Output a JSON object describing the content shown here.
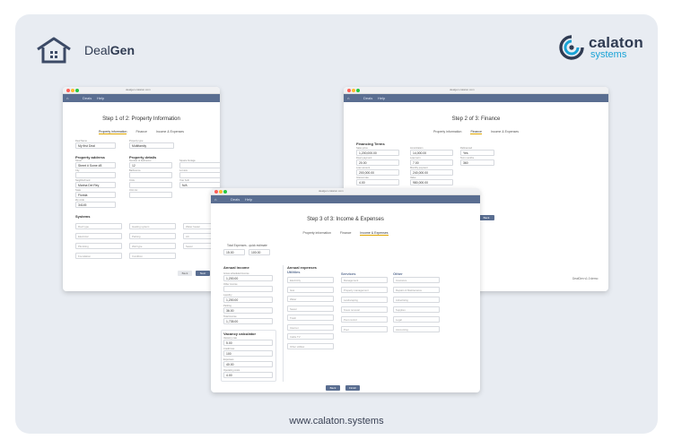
{
  "brand": {
    "left": {
      "regular": "Deal",
      "bold": "Gen"
    },
    "right": {
      "name": "calaton",
      "sub": "systems"
    }
  },
  "footer": {
    "url": "www.calaton.systems"
  },
  "window_common": {
    "url": "dealgen.calaton.com",
    "menu_deals": "Deals",
    "menu_help": "Help"
  },
  "win1": {
    "title": "Step 1 of 2: Property Information",
    "tabs": [
      "Property information",
      "Finance",
      "Income & Expenses"
    ],
    "top": {
      "lbl1": "Deal Name",
      "val1": "My first Deal",
      "lbl2": "Property type",
      "val2": "Multifamily"
    },
    "sections": {
      "address": "Property address",
      "details": "Property details",
      "systems": "Systems"
    },
    "address": [
      {
        "label": "Street",
        "value": "Street # Some #8"
      },
      {
        "label": "City",
        "value": ""
      },
      {
        "label": "Neighborhood",
        "value": "Marina Del Rey"
      },
      {
        "label": "State",
        "value": "Florida"
      },
      {
        "label": "Zip code",
        "value": "34145"
      }
    ],
    "details": [
      {
        "label": "Number of bedrooms",
        "value": "12"
      },
      {
        "label": "Bathrooms",
        "value": ""
      },
      {
        "label": "Units",
        "value": ""
      },
      {
        "label": "Unit mix",
        "value": ""
      },
      {
        "label": "Square footage",
        "value": ""
      },
      {
        "label": "Lot size",
        "value": ""
      },
      {
        "label": "Year built",
        "value": "N/A"
      }
    ],
    "systems": [
      "Roof type",
      "Heating system",
      "Water heater",
      "Electrical",
      "Parking",
      "AC",
      "Plumbing",
      "Well type",
      "Sewer",
      "Foundation",
      "Condition"
    ],
    "buttons": {
      "back": "Back",
      "next": "Next"
    }
  },
  "win2": {
    "title": "Step 2 of 3: Finance",
    "tabs": [
      "Property information",
      "Finance",
      "Income & Expenses"
    ],
    "section": "Financing Terms",
    "fields": [
      {
        "label": "Sales price",
        "value": "1,200,000.00"
      },
      {
        "label": "Down payment",
        "value": "20.00"
      },
      {
        "label": "Loan amount",
        "value": "200,000.00"
      },
      {
        "label": "Interest rate",
        "value": "4.00"
      },
      {
        "label": "Amortization",
        "value": "14,000.00"
      },
      {
        "label": "Loan term",
        "value": "7.00"
      },
      {
        "label": "Monthly payment",
        "value": "240,000.00"
      },
      {
        "label": "Value",
        "value": "980,000.00"
      },
      {
        "label": "Refinanced",
        "value": "Yes"
      },
      {
        "label": "Term months",
        "value": "360"
      }
    ],
    "buttons": {
      "back": "Back"
    },
    "footer_note": "DealGen v1.0 demo"
  },
  "win3": {
    "title": "Step 3 of 3: Income & Expenses",
    "tabs": [
      "Property information",
      "Finance",
      "Income & Expenses"
    ],
    "total_label": "Total Expenses - quick estimate",
    "total_vals": [
      "15.00",
      "100.00"
    ],
    "sections": {
      "annual_income": "Annual income",
      "annual_expenses": "Annual expenses",
      "utilities": "Utilities",
      "services": "Services",
      "other": "Other",
      "vacancy": "Vacancy calculator"
    },
    "income": [
      {
        "label": "Gross scheduled income",
        "value": "1,200.00"
      },
      {
        "label": "Other income",
        "value": ""
      },
      {
        "label": "Laundry",
        "value": "1,200.00"
      },
      {
        "label": "Parking",
        "value": "36.00"
      },
      {
        "label": "Total income",
        "value": "1,735.00"
      }
    ],
    "vacancy": [
      {
        "label": "Vacancy rate",
        "value": "5.00"
      },
      {
        "label": "Credit loss",
        "value": "100"
      },
      {
        "label": "Expenses",
        "value": "40.00"
      },
      {
        "label": "Operating costs",
        "value": "4.00"
      }
    ],
    "utilities": [
      "Electricity",
      "Gas",
      "Water",
      "Sewer",
      "Trash",
      "Internet",
      "Cable TV",
      "Other utilities"
    ],
    "services": [
      "Management",
      "Property management",
      "Landscaping",
      "Snow removal",
      "Pest control",
      "Pool"
    ],
    "other": [
      "Insurance",
      "Repairs & Maintenance",
      "Advertising",
      "Supplies",
      "Legal",
      "Accounting"
    ],
    "other_values": [
      "",
      "",
      "",
      "",
      "",
      "2.00"
    ],
    "buttons": {
      "back": "Back",
      "next": "Finish"
    }
  }
}
